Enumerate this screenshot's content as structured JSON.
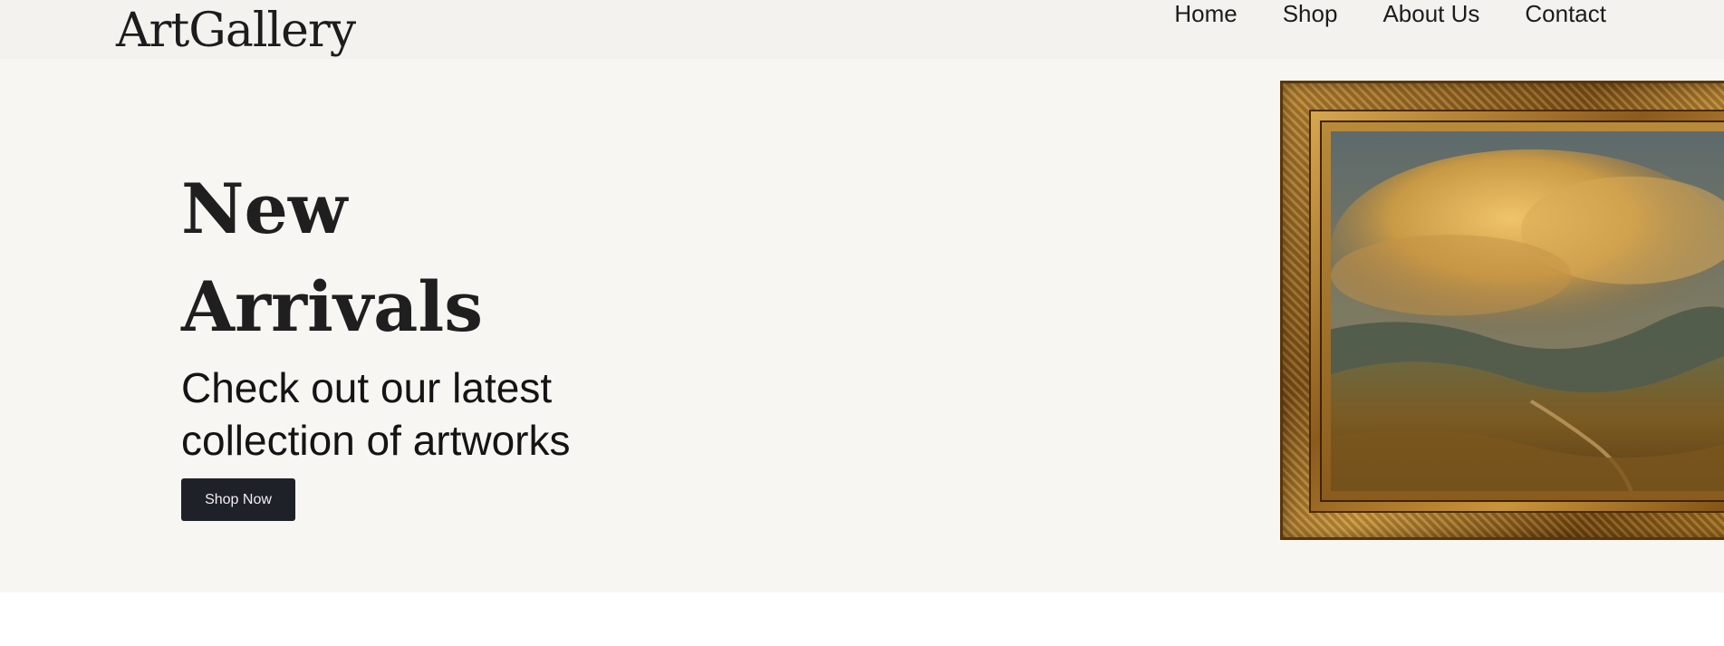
{
  "header": {
    "logo": "ArtGallery",
    "nav": [
      {
        "label": "Home"
      },
      {
        "label": "Shop"
      },
      {
        "label": "About Us"
      },
      {
        "label": "Contact"
      }
    ]
  },
  "hero": {
    "title_line1": "New",
    "title_line2": "Arrivals",
    "subtitle_line1": "Check out our latest",
    "subtitle_line2": "collection of artworks",
    "cta_label": "Shop Now",
    "image": "framed-landscape-painting"
  },
  "colors": {
    "header_bg": "#f4f2ee",
    "hero_bg": "#f8f6f2",
    "text": "#1f1f1f",
    "button_bg": "#1f2129",
    "button_text": "#f0f0f0",
    "frame_gold": "#a87727"
  }
}
